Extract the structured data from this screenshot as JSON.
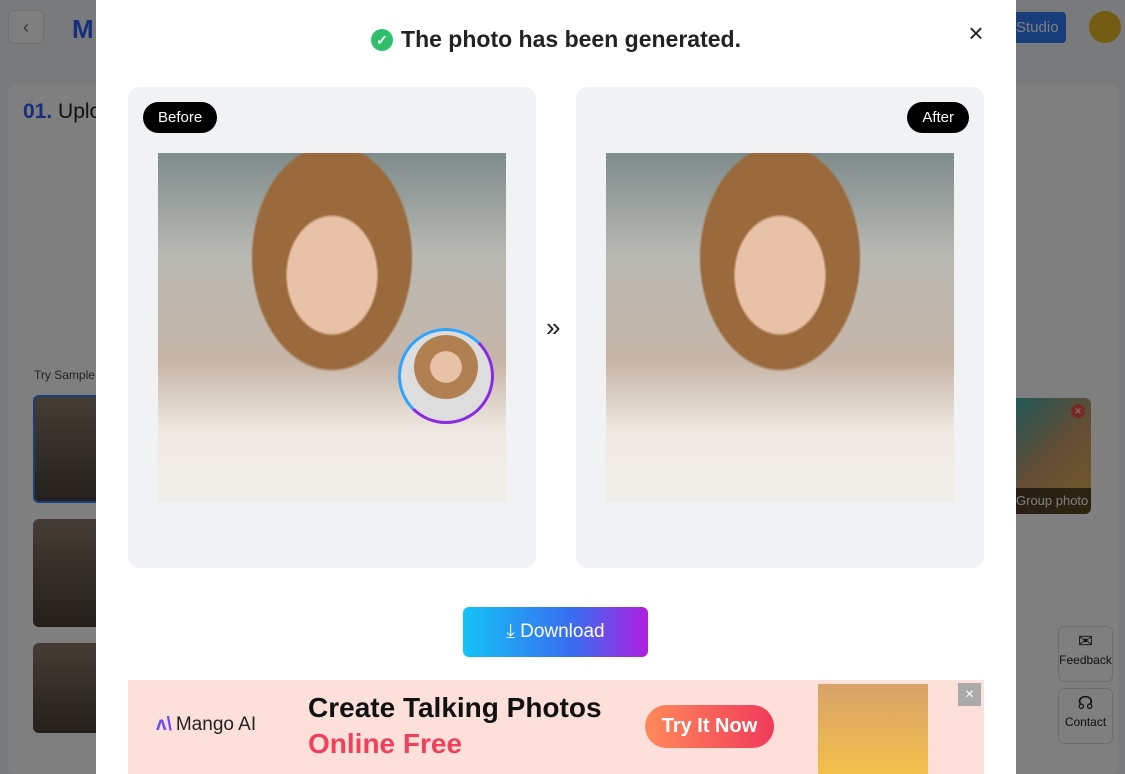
{
  "background": {
    "logo": "M",
    "studio_label": "Studio",
    "step_number": "01.",
    "step_title": "Upload",
    "try_sample": "Try Sample",
    "group_photo_label": "Group photo",
    "feedback": "Feedback",
    "contact": "Contact"
  },
  "modal": {
    "title": "The photo has been generated.",
    "before_label": "Before",
    "after_label": "After",
    "arrow": "»",
    "download_label": "Download",
    "close": "×"
  },
  "ad": {
    "brand": "Mango AI",
    "headline": "Create Talking Photos",
    "subheadline": "Online Free",
    "cta": "Try It Now",
    "close": "×"
  },
  "colors": {
    "accent": "#2f5bff",
    "success": "#2fbf6a",
    "ad_red": "#f0405a"
  }
}
